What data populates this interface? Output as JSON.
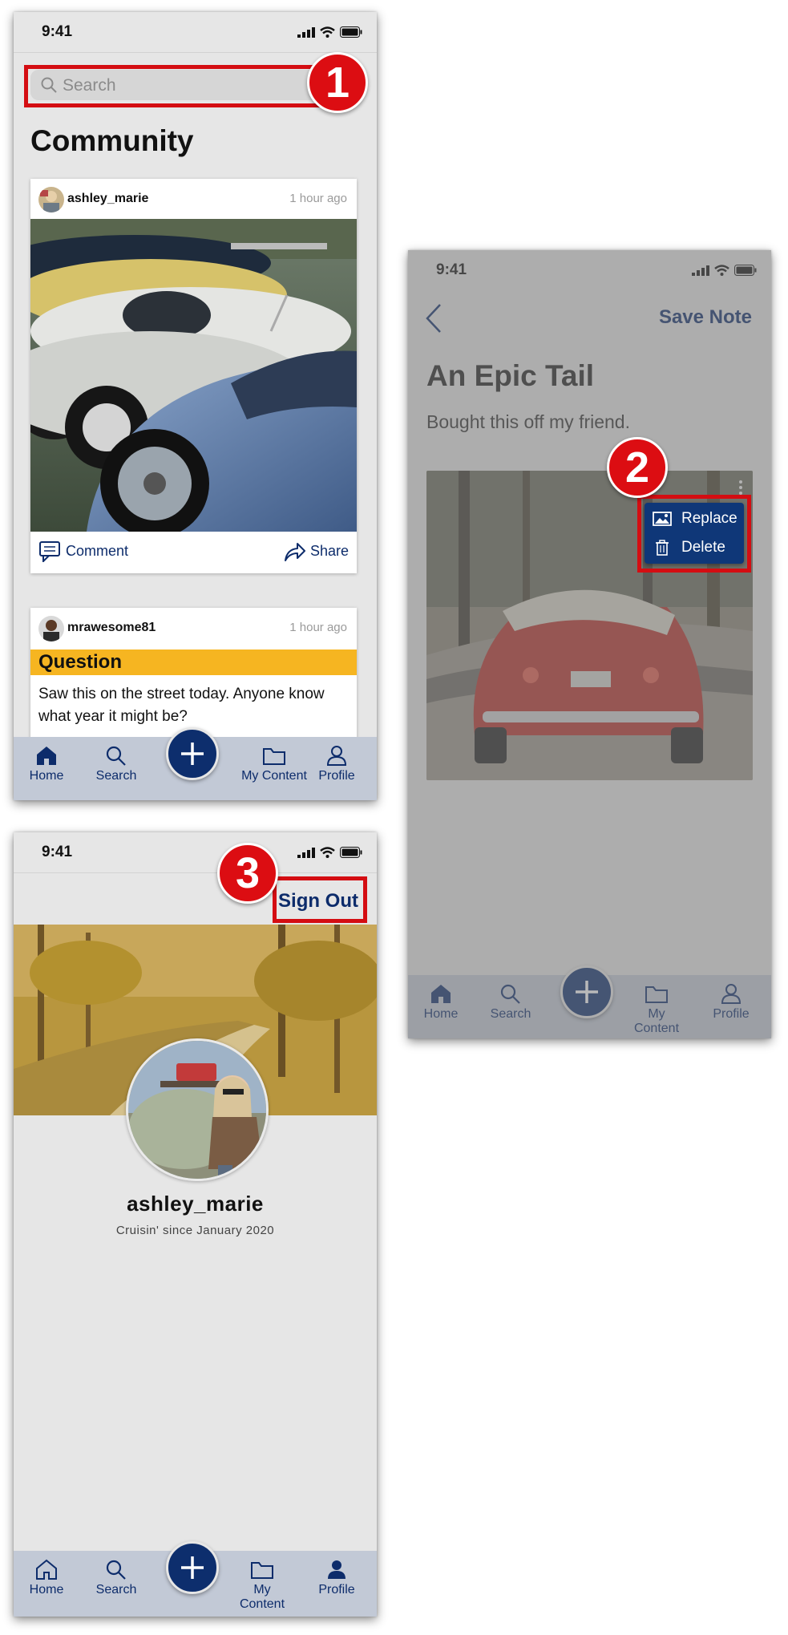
{
  "status_bar": {
    "time": "9:41"
  },
  "colors": {
    "brand_navy": "#0d2c6b",
    "callout_red": "#d40d12",
    "question_yellow": "#f6b521",
    "tabbar_bg": "#c2c9d6",
    "screen_bg": "#e6e6e6"
  },
  "callouts": [
    "1",
    "2",
    "3"
  ],
  "community_screen": {
    "search_placeholder": "Search",
    "title": "Community",
    "posts": [
      {
        "username": "ashley_marie",
        "time": "1 hour ago",
        "image": "vintage-beetles-photo",
        "actions": {
          "comment": "Comment",
          "share": "Share"
        }
      },
      {
        "username": "mrawesome81",
        "time": "1 hour ago",
        "tag": "Question",
        "body": "Saw this on the street today. Anyone know what year it might be?"
      }
    ]
  },
  "note_screen": {
    "save_label": "Save Note",
    "title": "An Epic Tail",
    "body": "Bought this off my friend.",
    "image": "red-convertible-beetle-photo",
    "menu": {
      "replace": "Replace",
      "delete": "Delete"
    }
  },
  "profile_screen": {
    "sign_out": "Sign Out",
    "username": "ashley_marie",
    "since": "Cruisin' since January 2020",
    "cover_image": "autumn-road-photo",
    "avatar_image": "woman-with-beetle-photo"
  },
  "tab_bar": {
    "items": [
      {
        "label": "Home",
        "icon": "home-icon"
      },
      {
        "label": "Search",
        "icon": "search-icon"
      },
      {
        "label": "My Content",
        "icon": "folder-icon"
      },
      {
        "label": "Profile",
        "icon": "person-icon"
      }
    ],
    "fab_icon": "plus-icon"
  }
}
